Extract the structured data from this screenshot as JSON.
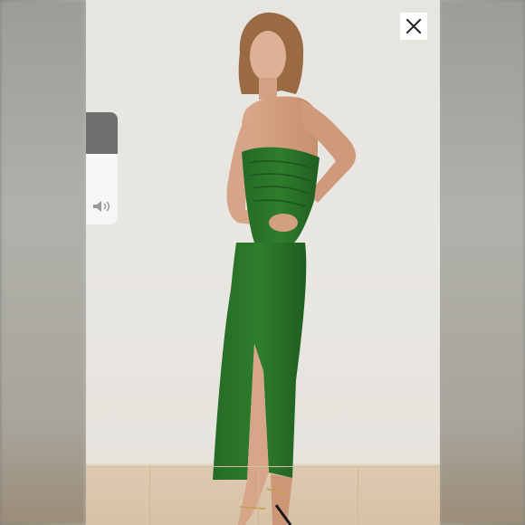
{
  "viewer": {
    "close_icon": "close-icon",
    "volume_icon": "speaker-icon",
    "volume_level": 0.63,
    "accent_colors": {
      "dress": "#2f7a2c",
      "wall": "#e8e6e1",
      "floor": "#d9c4a8",
      "overlay": "#ffffff"
    }
  }
}
